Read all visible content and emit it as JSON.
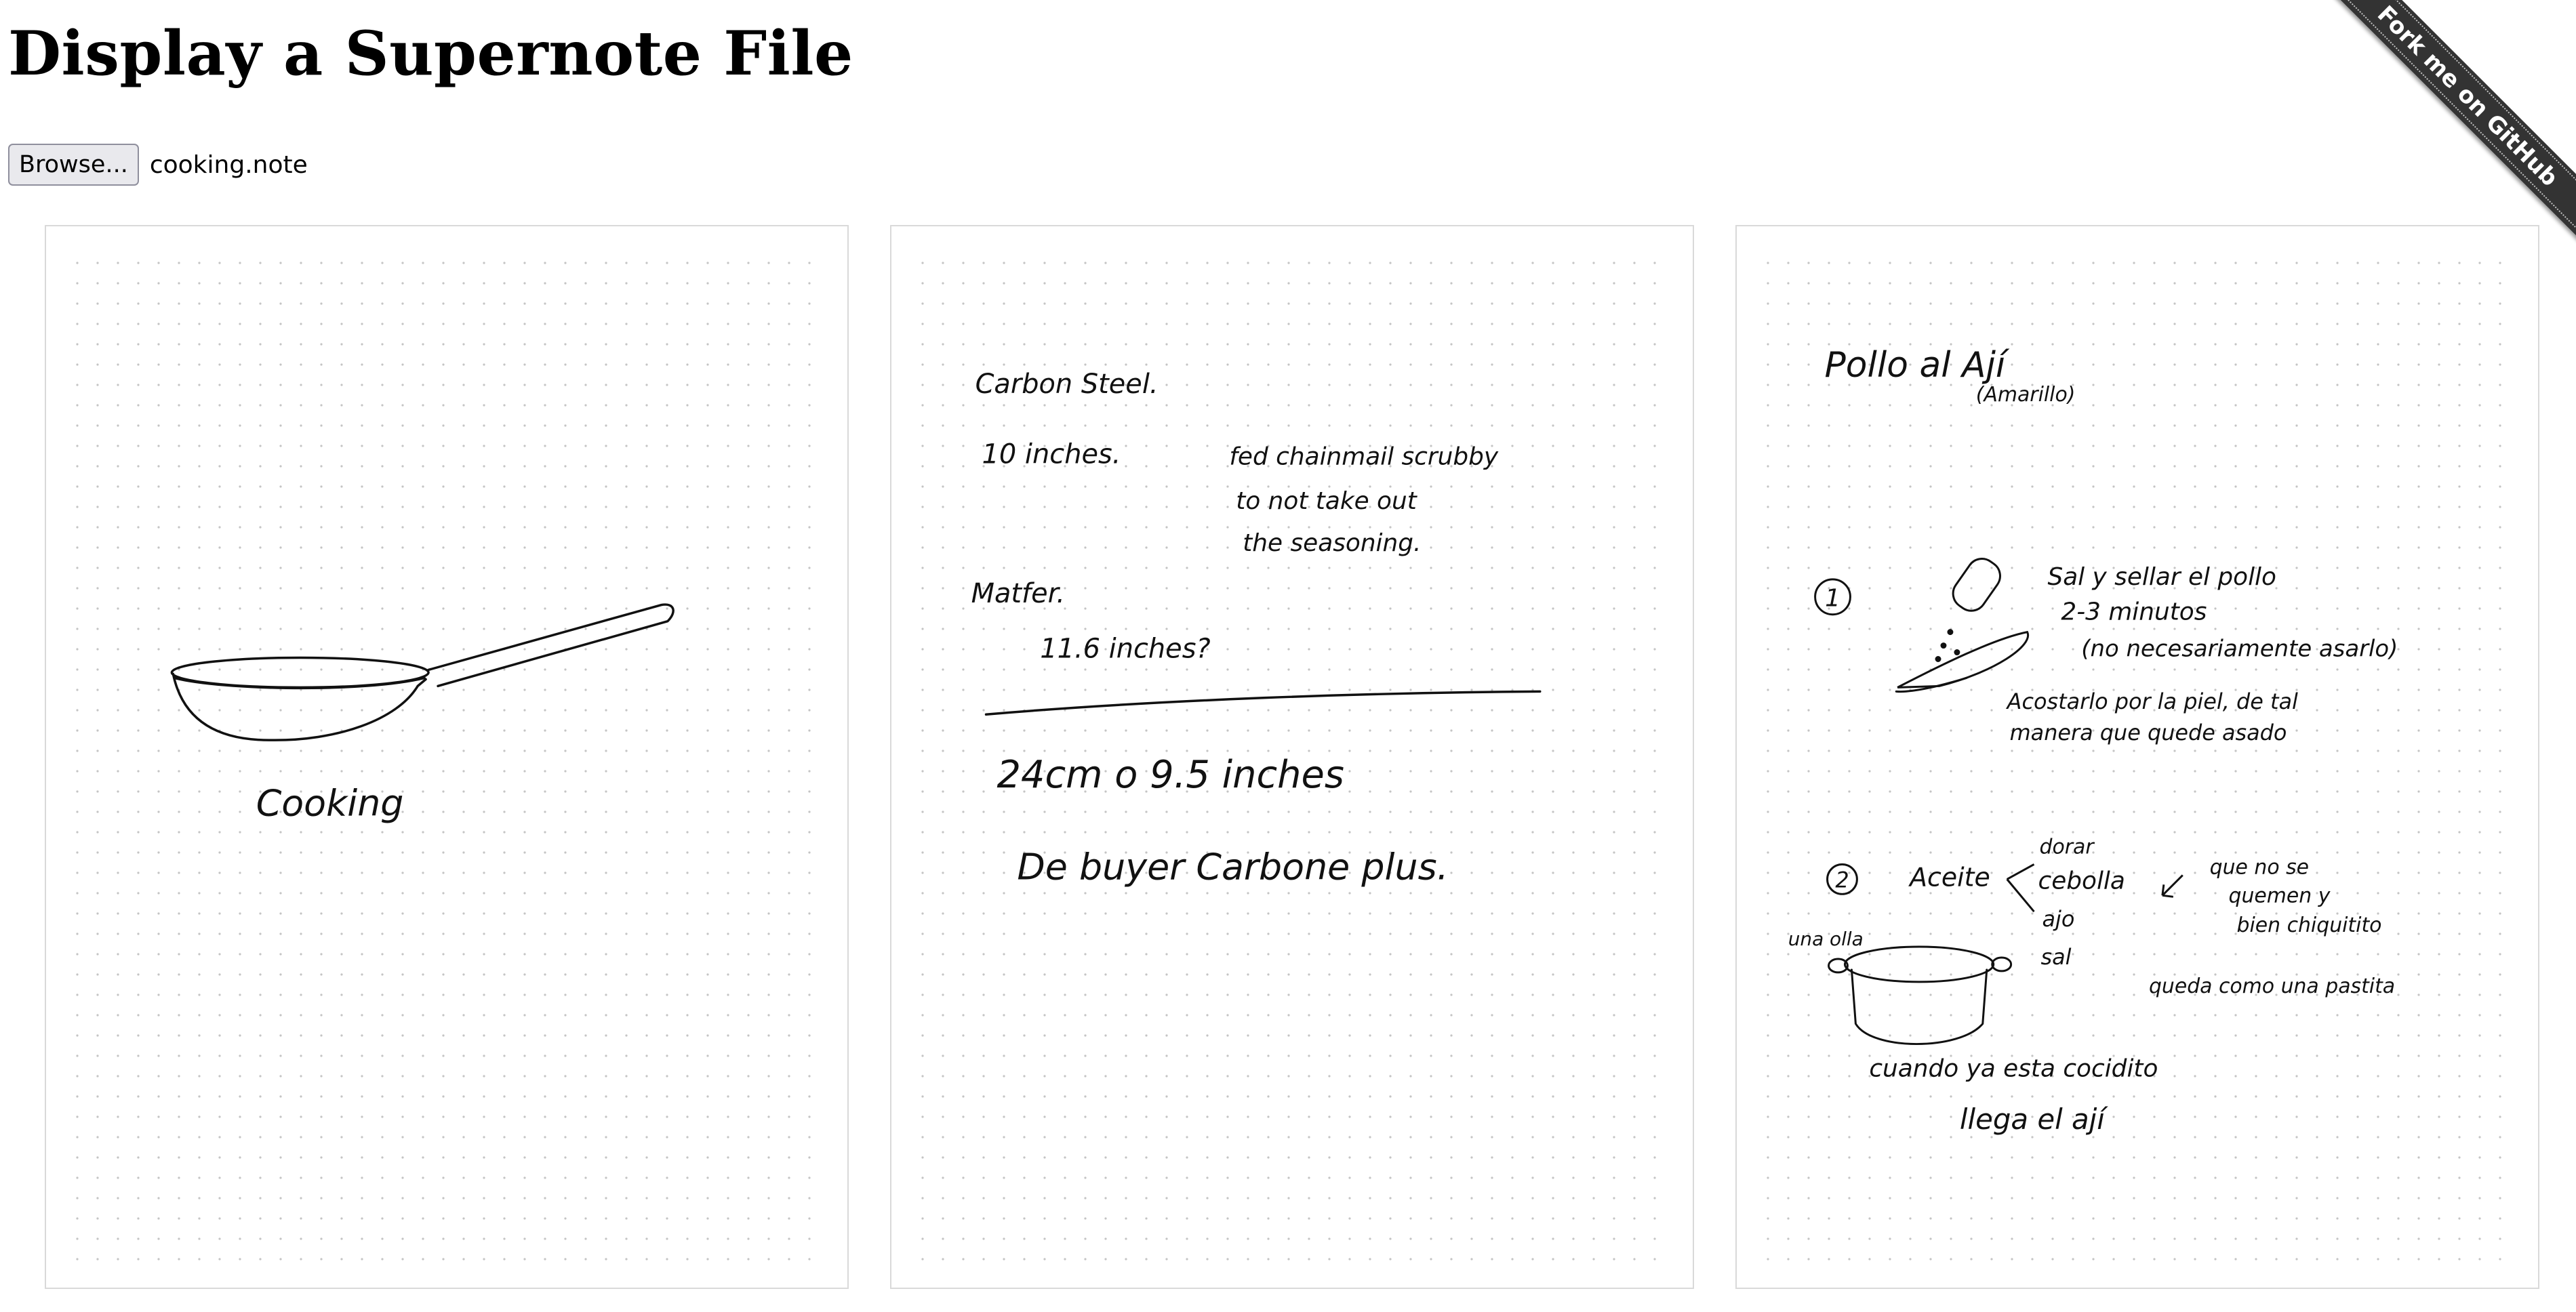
{
  "heading": "Display a Supernote File",
  "file_input": {
    "button_label": "Browse...",
    "file_name": "cooking.note"
  },
  "ribbon": {
    "label": "Fork me on GitHub"
  },
  "pages": [
    {
      "lines": [
        "Cooking"
      ]
    },
    {
      "lines": [
        "Carbon Steel.",
        "10 inches.",
        "fed chainmail scrubby",
        "to not take out",
        "the seasoning.",
        "Matfer.",
        "11.6 inches?",
        "24cm o 9.5 inches",
        "De buyer Carbone plus."
      ]
    },
    {
      "lines": [
        "Pollo al Ají",
        "(Amarillo)",
        "1",
        "Sal y sellar el pollo",
        "2-3 minutos",
        "(no necesariamente asarlo)",
        "Acostarlo por la piel, de tal",
        "manera que quede asado",
        "2",
        "Aceite",
        "dorar",
        "cebolla",
        "ajo",
        "sal",
        "que no se",
        "quemen y",
        "bien chiquitito",
        "una olla",
        "queda como una pastita",
        "cuando ya esta cocidito",
        "llega el ají"
      ]
    }
  ]
}
